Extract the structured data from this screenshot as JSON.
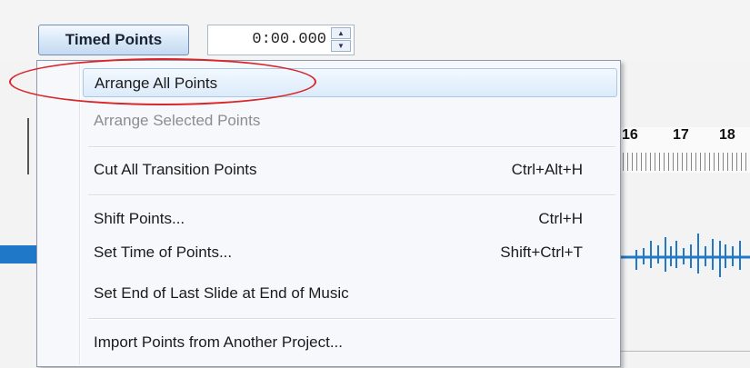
{
  "toolbar": {
    "timed_points_label": "Timed Points",
    "time_value": "0:00.000",
    "spin_up": "▲",
    "spin_down": "▼"
  },
  "ruler": {
    "numbers": [
      "16",
      "17",
      "18"
    ]
  },
  "menu": {
    "items": [
      {
        "label": "Arrange All Points",
        "shortcut": "",
        "state": "hover"
      },
      {
        "label": "Arrange Selected Points",
        "shortcut": "",
        "state": "disabled"
      },
      {
        "label": "Cut All Transition Points",
        "shortcut": "Ctrl+Alt+H",
        "state": "normal"
      },
      {
        "label": "Shift Points...",
        "shortcut": "Ctrl+H",
        "state": "normal"
      },
      {
        "label": "Set Time of Points...",
        "shortcut": "Shift+Ctrl+T",
        "state": "normal"
      },
      {
        "label": "Set End of Last Slide at End of Music",
        "shortcut": "",
        "state": "normal"
      },
      {
        "label": "Import Points from Another Project...",
        "shortcut": "",
        "state": "normal"
      }
    ]
  },
  "colors": {
    "annotation": "#d9262a",
    "waveform": "#1f78c8",
    "hover_fill": "#dcebfa"
  }
}
